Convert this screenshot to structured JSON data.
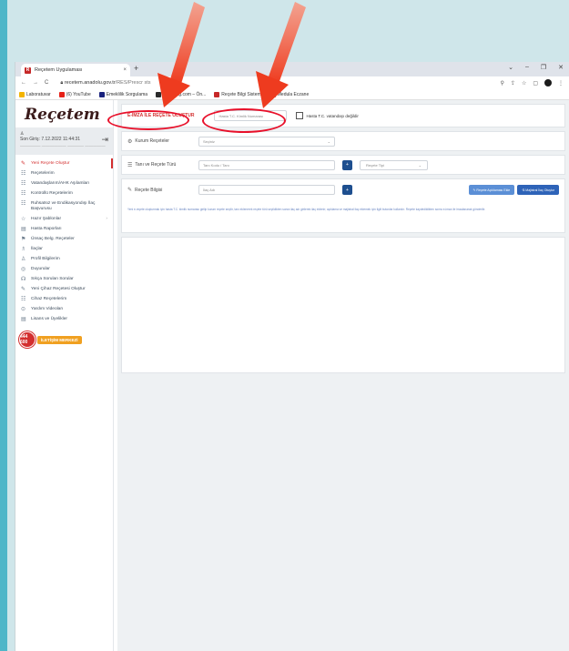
{
  "browser": {
    "tab_title": "Reçetem Uygulaması",
    "tab_close": "×",
    "new_tab": "+",
    "window_controls": [
      "⌄",
      "–",
      "❐",
      "✕"
    ],
    "url_host": "recetem.anadolu.gov.tr",
    "url_path": "/RES/Prescr",
    "url_tail": "sts",
    "nav": [
      "←",
      "→",
      "C"
    ],
    "addr_icons": [
      "⚲",
      "⇪",
      "☆",
      "▢"
    ],
    "menu_dots": "⋮"
  },
  "bookmarks": [
    {
      "label": "Laboratuvar",
      "color": "#f4b400"
    },
    {
      "label": "(6) YouTube",
      "color": "#e62117"
    },
    {
      "label": "Emeklilik Sorgulama",
      "color": "#1a237e"
    },
    {
      "label": "Investing.com – Ön...",
      "color": "#2b2b2b"
    },
    {
      "label": "Reçete Bilgi Sistemi",
      "color": "#c62828"
    },
    {
      "label": "Medula Eczane",
      "color": "#444444"
    }
  ],
  "sidebar": {
    "logo": "Reçetem",
    "user_icon": "♙",
    "user_line1": "Son Giriş: 7.12.2022 11:44:31",
    "user_line2": "—————  ——————  ———— —————",
    "logout_icon": "⇥",
    "items": [
      {
        "label": "Yeni Reçete Oluştur",
        "icon": "✎",
        "active": true
      },
      {
        "label": "Reçetelerim",
        "icon": "☷"
      },
      {
        "label": "Vatandaşlarım/AHK Aşılamları",
        "icon": "☷"
      },
      {
        "label": "Kontrollü Reçetelerim",
        "icon": "☷"
      },
      {
        "label": "Ruhsatsız ve Endikasyondışı İlaç Başvurusu",
        "icon": "☷"
      },
      {
        "label": "Hazır Şablonlar",
        "icon": "☆",
        "arrow": "›"
      },
      {
        "label": "Hasta Raporları",
        "icon": "▤"
      },
      {
        "label": "Ünsaç Belg. Reçeteler",
        "icon": "⚑"
      },
      {
        "label": "İlaçlar",
        "icon": "♗"
      },
      {
        "label": "Profil Bilgilerim",
        "icon": "♙"
      },
      {
        "label": "Duyurular",
        "icon": "◎"
      },
      {
        "label": "Sıkça Sorulan Sorular",
        "icon": "☊"
      },
      {
        "label": "Yeni Çihaz Reçetesi Oluştur",
        "icon": "✎"
      },
      {
        "label": "Cihaz Reçetelerim",
        "icon": "☷"
      },
      {
        "label": "Yardım Videoları",
        "icon": "⊙"
      },
      {
        "label": "Lisans ve Üyelikler",
        "icon": "▤"
      }
    ],
    "badge_num": "444 600",
    "badge_text": "İLETİŞİM MERKEZİ"
  },
  "main": {
    "title": "E-İMZA İLE REÇETE OLUŞTUR",
    "tc_placeholder": "Hasta T.C. Kimlik Numarası",
    "tc_checkbox_label": "Hasta T.C. vatandaşı değildir",
    "row1_label": "Kurum Reçeteler",
    "row1_icon": "⚙",
    "row1_select": "Seçiniz",
    "row1_caret": "⌄",
    "row2_label": "Tanı ve Reçete Türü",
    "row2_icon": "☰",
    "row2_input": "Tanı Kodu / Tanı",
    "row2_btn": "+",
    "row2_select": "Reçete Tipi",
    "row2_caret": "⌄",
    "row3_label": "Reçete Bilgisi",
    "row3_icon": "✎",
    "row3_input": "İlaç Adı",
    "row3_btn": "+",
    "row3_btn_light": "✎ Reçete Açıklaması Ekle",
    "row3_btn_dark": "⚗ Majistral İlaç Oluştur",
    "info_line": "Yeni e-reçete oluşturmak için hasta T.C. kimlik numarası girilip kurum reçete seçilir, tanı eklenerek reçete türü seçildikten sonra ilaç adı girilerek ilaç eklenir; açıklama ve majistral ilaç eklemek için ilgili butonlar kullanılır. Reçete kaydedildikten sonra e-imza ile imzalanarak gönderilir."
  }
}
